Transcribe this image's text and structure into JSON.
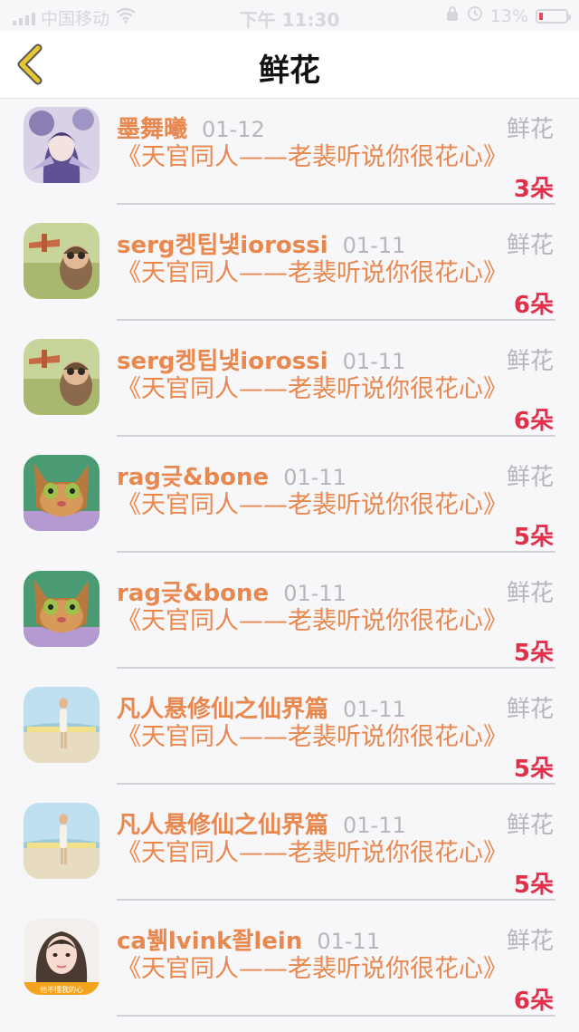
{
  "status_bar": {
    "carrier": "中国移动",
    "time": "下午 11:30",
    "battery": "13%",
    "icons": [
      "signal-icon",
      "wifi-icon",
      "lock-rotation-icon",
      "alarm-icon",
      "battery-icon"
    ]
  },
  "nav": {
    "title": "鲜花",
    "back_icon": "chevron-left-icon"
  },
  "colors": {
    "name": "#e8884f",
    "meta": "#b8b6ba",
    "count": "#e0304a",
    "back_icon": "#e8c630"
  },
  "items": [
    {
      "user": "墨舞曦",
      "date": "01-12",
      "type": "鲜花",
      "title": "《天官同人——老裴听说你很花心》",
      "count": "3朵",
      "avatar": "anime-girl"
    },
    {
      "user": "serg켕팁냋iorossi",
      "date": "01-11",
      "type": "鲜花",
      "title": "《天官同人——老裴听说你很花心》",
      "count": "6朵",
      "avatar": "pilot"
    },
    {
      "user": "serg켕팁냋iorossi",
      "date": "01-11",
      "type": "鲜花",
      "title": "《天官同人——老裴听说你很花心》",
      "count": "6朵",
      "avatar": "pilot"
    },
    {
      "user": "rag긎&bone",
      "date": "01-11",
      "type": "鲜花",
      "title": "《天官同人——老裴听说你很花心》",
      "count": "5朵",
      "avatar": "cat"
    },
    {
      "user": "rag긎&bone",
      "date": "01-11",
      "type": "鲜花",
      "title": "《天官同人——老裴听说你很花心》",
      "count": "5朵",
      "avatar": "cat"
    },
    {
      "user": "凡人悬修仙之仙界篇",
      "date": "01-11",
      "type": "鲜花",
      "title": "《天官同人——老裴听说你很花心》",
      "count": "5朵",
      "avatar": "beach"
    },
    {
      "user": "凡人悬修仙之仙界篇",
      "date": "01-11",
      "type": "鲜花",
      "title": "《天官同人——老裴听说你很花心》",
      "count": "5朵",
      "avatar": "beach"
    },
    {
      "user": "ca뷁lvink좔lein",
      "date": "01-11",
      "type": "鲜花",
      "title": "《天官同人——老裴听说你很花心》",
      "count": "6朵",
      "avatar": "girl",
      "avatar_caption": "他不懂我的心"
    }
  ]
}
